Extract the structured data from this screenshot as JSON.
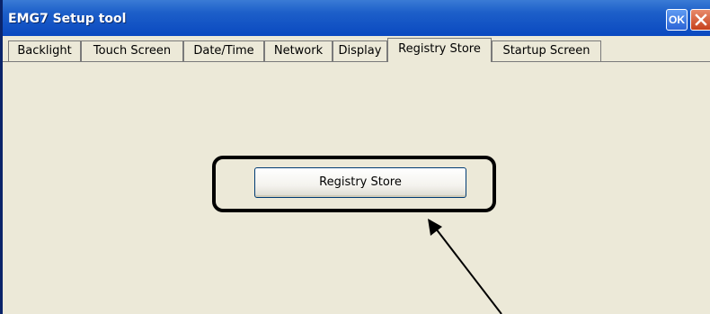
{
  "window": {
    "title": "EMG7 Setup tool",
    "ok_label": "OK"
  },
  "tabs": [
    {
      "label": "Backlight",
      "active": false
    },
    {
      "label": "Touch Screen",
      "active": false
    },
    {
      "label": "Date/Time",
      "active": false
    },
    {
      "label": "Network",
      "active": false
    },
    {
      "label": "Display",
      "active": false
    },
    {
      "label": "Registry Store",
      "active": true
    },
    {
      "label": "Startup Screen",
      "active": false
    }
  ],
  "content": {
    "registry_store_button_label": "Registry Store"
  },
  "colors": {
    "titlebar": "#0a49c0",
    "window_bg": "#ece9d8",
    "close_button": "#c6411c",
    "annotation": "#000000"
  },
  "icons": {
    "close": "close-icon",
    "annotation_arrow": "annotation-arrow"
  }
}
